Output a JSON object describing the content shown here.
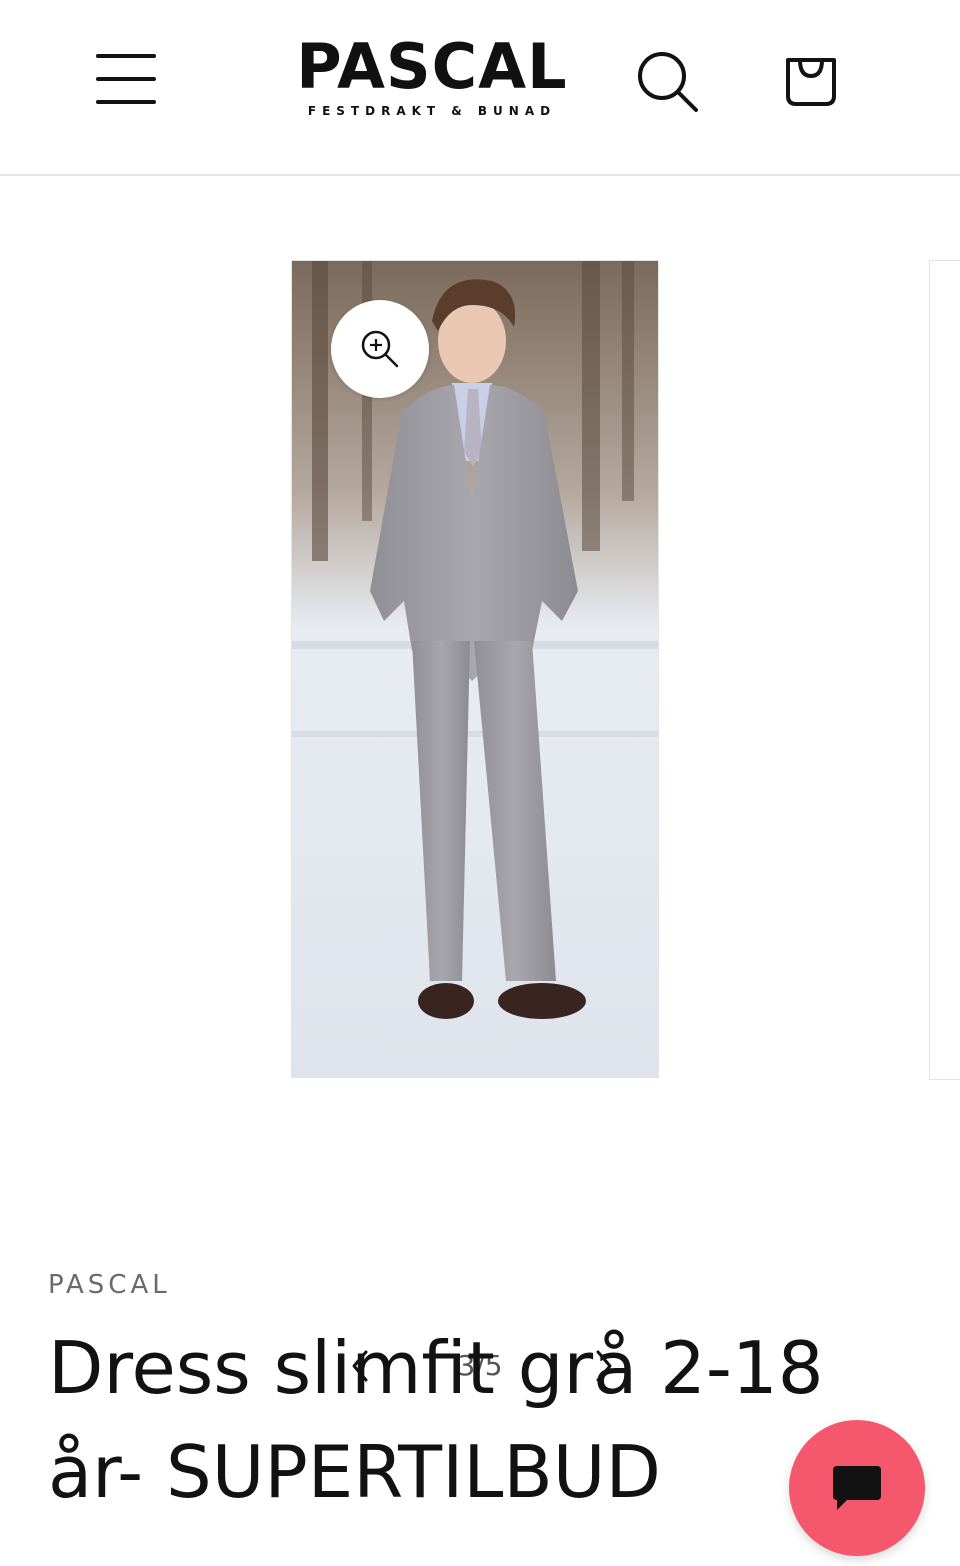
{
  "header": {
    "brand_name": "PASCAL",
    "brand_tagline": "FESTDRAKT & BUNAD",
    "menu_icon": "hamburger-menu-icon",
    "search_icon": "search-icon",
    "cart_icon": "shopping-bag-icon"
  },
  "gallery": {
    "image_alt": "Dress slimfit grå 2-18 år- SUPERTILBUD",
    "zoom_icon": "zoom-in-icon",
    "counter": "3/5",
    "prev_icon": "chevron-left-icon",
    "next_icon": "chevron-right-icon"
  },
  "product": {
    "vendor": "PASCAL",
    "title": "Dress slimfit grå 2-18 år- SUPERTILBUD"
  },
  "chat": {
    "icon": "chat-bubble-icon",
    "color": "#f5576c"
  }
}
